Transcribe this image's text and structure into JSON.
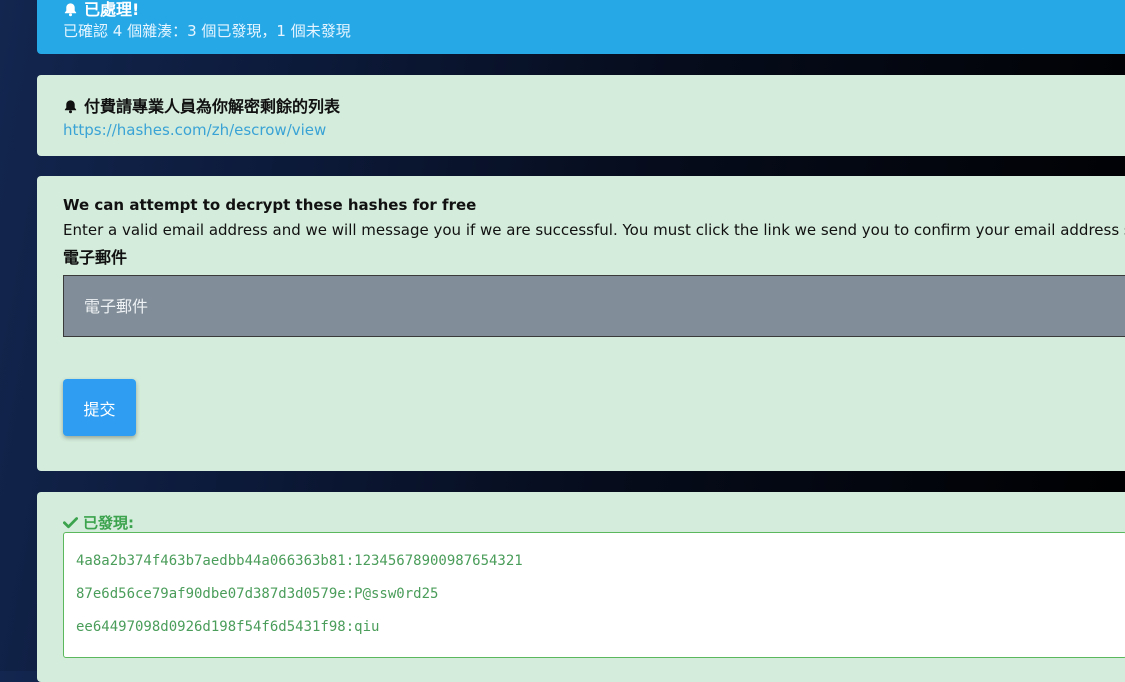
{
  "notice": {
    "title": "已處理!",
    "message": "已確認 4 個雜湊：3 個已發現，1 個未發現"
  },
  "escrow": {
    "title": "付費請專業人員為你解密剩餘的列表",
    "link": "https://hashes.com/zh/escrow/view"
  },
  "decrypt_form": {
    "heading": "We can attempt to decrypt these hashes for free",
    "description": "Enter a valid email address and we will message you if we are successful. You must click the link we send you to confirm your email address so pro",
    "email_label": "電子郵件",
    "email_placeholder": "電子郵件",
    "submit_label": "提交"
  },
  "found": {
    "title": "已發現:",
    "rows": [
      "4a8a2b374f463b7aedbb44a066363b81:12345678900987654321",
      "87e6d56ce79af90dbe07d387d3d0579e:P@ssw0rd25",
      "ee64497098d0926d198f54f6d5431f98:qiu"
    ]
  },
  "colors": {
    "info_blue": "#27a8e6",
    "panel_green": "#d4ecdb",
    "success_green": "#3ba34d",
    "button_blue": "#2f9ef2",
    "link_blue": "#3aa3d6"
  },
  "icons": {
    "notice": "bell-icon",
    "escrow": "bell-icon",
    "found": "check-icon"
  }
}
